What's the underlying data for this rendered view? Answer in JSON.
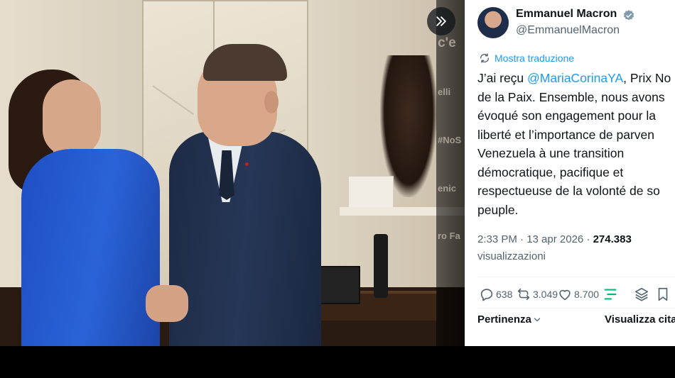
{
  "media": {
    "expand_icon": "double-chevron-right-icon",
    "partial_overlay_texts": [
      "c'e",
      "elli",
      "#NoS",
      "enic",
      "ro Fa"
    ]
  },
  "tweet": {
    "author_name": "Emmanuel Macron",
    "verified_icon": "verified-badge-icon",
    "handle": "@EmmanuelMacron",
    "translate_label": "Mostra traduzione",
    "text_lines": [
      {
        "before": "J’ai reçu ",
        "mention": "@MariaCorinaYA",
        "after": ", Prix No"
      },
      {
        "before": "de la Paix. Ensemble, nous avons",
        "mention": "",
        "after": ""
      },
      {
        "before": "évoqué son engagement pour la",
        "mention": "",
        "after": ""
      },
      {
        "before": "liberté et l’importance de parven",
        "mention": "",
        "after": ""
      },
      {
        "before": "Venezuela à une transition",
        "mention": "",
        "after": ""
      },
      {
        "before": "démocratique, pacifique et",
        "mention": "",
        "after": ""
      },
      {
        "before": "respectueuse de la volonté de so",
        "mention": "",
        "after": ""
      },
      {
        "before": "peuple.",
        "mention": "",
        "after": ""
      }
    ],
    "timestamp": "2:33 PM · 13 apr 2026 · ",
    "views_count": "274.383",
    "views_label": "visualizzazioni",
    "actions": {
      "replies": "638",
      "retweets": "3.049",
      "likes": "8.700"
    },
    "sort_label": "Pertinenza",
    "see_quotes_label": "Visualizza cita"
  },
  "colors": {
    "accent": "#1d9bf0",
    "text_primary": "#0f1419",
    "text_secondary": "#536471",
    "like_green": "#00ba7c"
  }
}
